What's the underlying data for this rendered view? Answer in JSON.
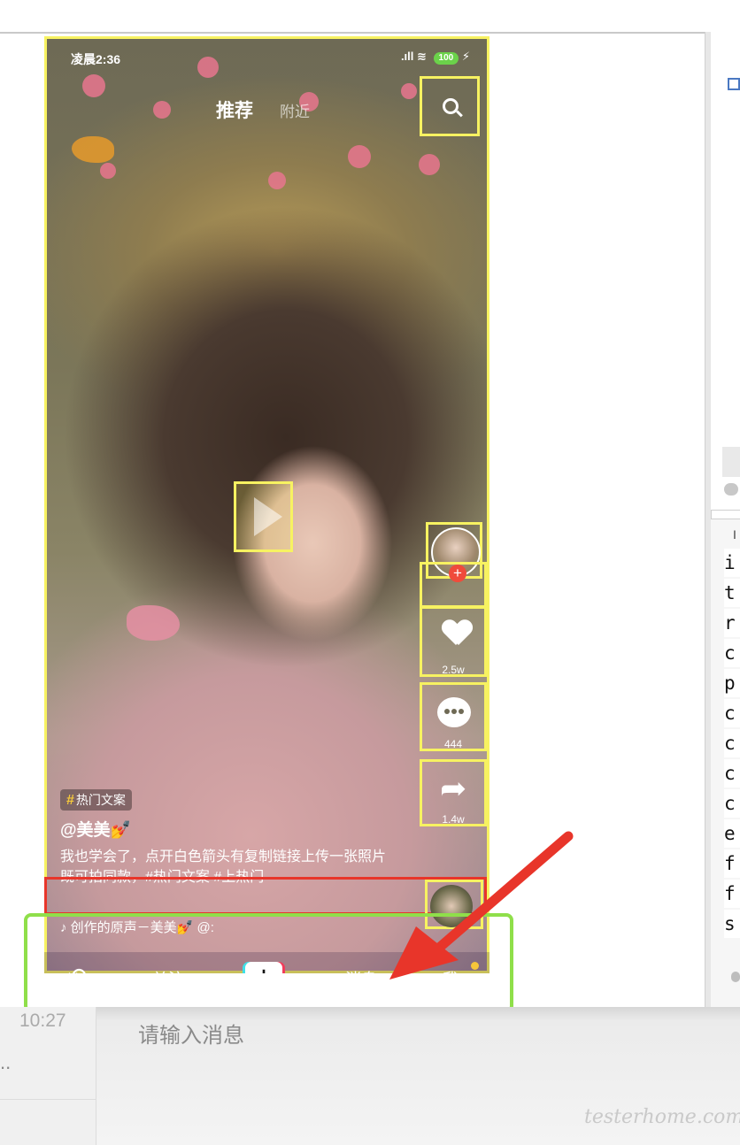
{
  "status_bar": {
    "time": "凌晨2:36",
    "signal": ".ıll",
    "wifi": "wifi",
    "battery": "100"
  },
  "top_tabs": {
    "recommend": "推荐",
    "nearby": "附近"
  },
  "side": {
    "likes": "2.5w",
    "comments": "444",
    "shares": "1.4w",
    "follow_plus": "+"
  },
  "post": {
    "tag": "热门文案",
    "username": "@美美💅",
    "caption": "我也学会了，点开白色箭头有复制链接上传一张照片既可拍同款，#热门文案 #上热门",
    "music": "♪ 创作的原声－美美💅  @:"
  },
  "nav": {
    "refresh": "⟲",
    "follow": "关注",
    "add": "+",
    "messages": "消息",
    "me": "我"
  },
  "chat": {
    "time": "10:27",
    "ellipsis": "..",
    "input_placeholder": "请输入消息",
    "watermark": "testerhome.com"
  },
  "right_panel": {
    "letters": [
      "i",
      "t",
      "r",
      "c",
      "p",
      "c",
      "c",
      "c",
      "c",
      "e",
      "f",
      "f",
      "s"
    ],
    "mark": "I"
  },
  "colors": {
    "highlight_yellow": "#f7f261",
    "highlight_red": "#e8352a",
    "highlight_green": "#8fdf4a",
    "accent_orange": "#f04b3b"
  }
}
